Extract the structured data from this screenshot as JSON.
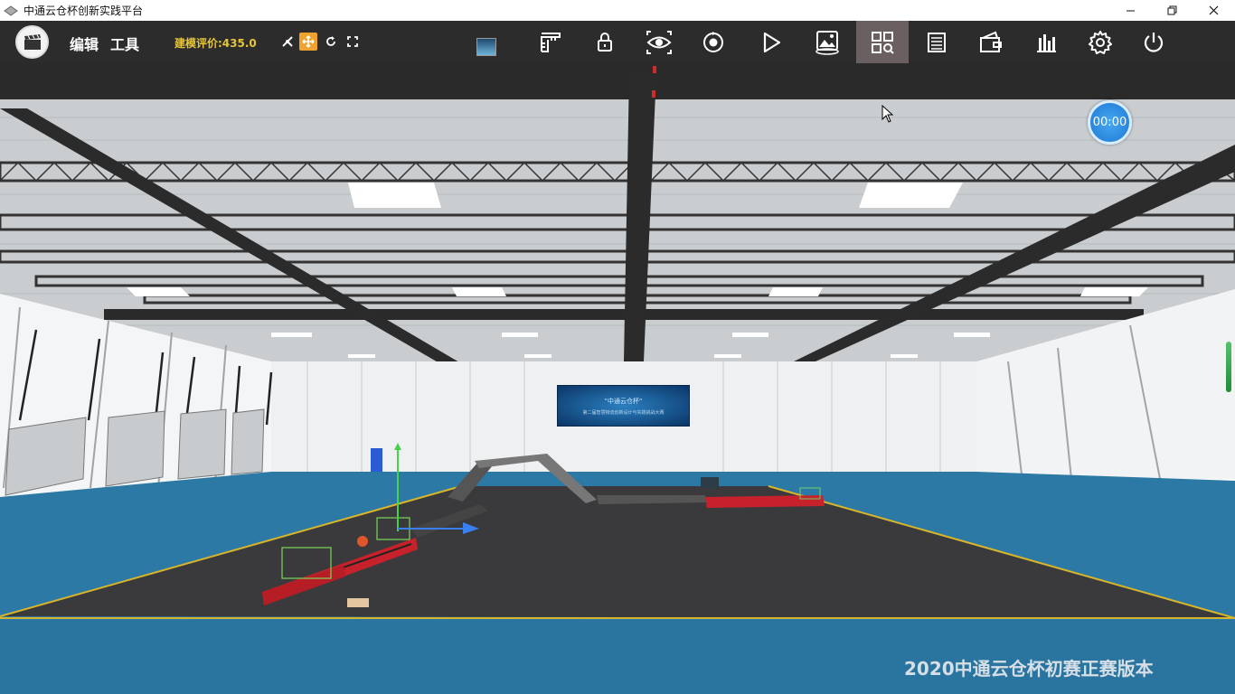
{
  "window": {
    "title": "中通云仓杯创新实践平台"
  },
  "toolbar": {
    "menu": [
      "编辑",
      "工具"
    ],
    "score_text": "建模评价:435.0",
    "small_tools": [
      "snap-icon",
      "move-icon",
      "rotate-icon",
      "fullscreen-icon"
    ],
    "active_small_tool": "move-icon",
    "buttons": [
      "ruler-icon",
      "lock-icon",
      "eye-icon",
      "record-icon",
      "play-icon",
      "panorama-360-icon",
      "grid-search-icon",
      "list-icon",
      "wallet-icon",
      "bar-chart-icon",
      "settings-icon",
      "power-icon"
    ],
    "active_button": "grid-search-icon",
    "accent_color": "#f0a22e"
  },
  "viewport": {
    "timer": "00:00",
    "banner_title": "\"中通云仓杯\"",
    "banner_subtitle": "第二届智慧物流创新设计与实践挑战大赛",
    "watermark": "2020中通云仓杯初赛正赛版本",
    "floor_color": "#2d79a5"
  }
}
